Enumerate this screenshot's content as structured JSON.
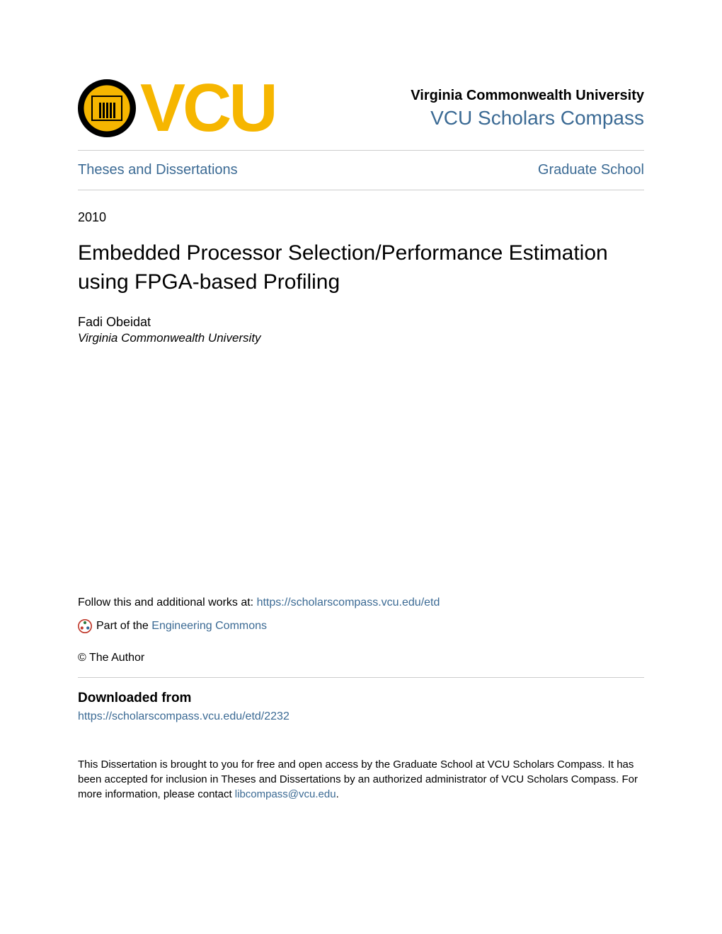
{
  "header": {
    "logo_text": "VCU",
    "institution_name": "Virginia Commonwealth University",
    "compass_link": "VCU Scholars Compass"
  },
  "nav": {
    "left": "Theses and Dissertations",
    "right": "Graduate School"
  },
  "metadata": {
    "year": "2010",
    "title": "Embedded Processor Selection/Performance Estimation using FPGA-based Profiling",
    "author_name": "Fadi Obeidat",
    "author_affiliation": "Virginia Commonwealth University"
  },
  "follow": {
    "prefix": "Follow this and additional works at: ",
    "url": "https://scholarscompass.vcu.edu/etd"
  },
  "part_of": {
    "prefix": "Part of the ",
    "link_text": "Engineering Commons"
  },
  "copyright": "© The Author",
  "downloaded": {
    "heading": "Downloaded from",
    "url": "https://scholarscompass.vcu.edu/etd/2232"
  },
  "footer": {
    "text_part1": "This Dissertation is brought to you for free and open access by the Graduate School at VCU Scholars Compass. It has been accepted for inclusion in Theses and Dissertations by an authorized administrator of VCU Scholars Compass. For more information, please contact ",
    "contact_email": "libcompass@vcu.edu",
    "text_part2": "."
  }
}
